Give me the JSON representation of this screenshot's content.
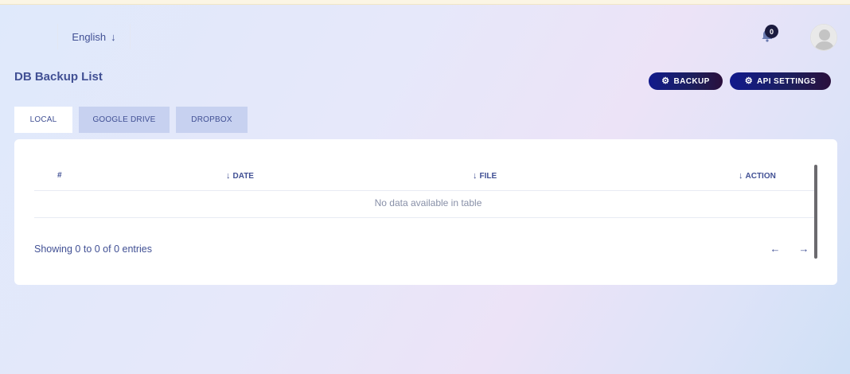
{
  "header": {
    "language": "English",
    "notification_count": "0"
  },
  "page": {
    "title": "DB Backup List"
  },
  "actions": {
    "backup_label": "BACKUP",
    "api_settings_label": "API SETTINGS"
  },
  "tabs": [
    {
      "label": "LOCAL",
      "active": true
    },
    {
      "label": "GOOGLE DRIVE",
      "active": false
    },
    {
      "label": "DROPBOX",
      "active": false
    }
  ],
  "table": {
    "columns": [
      "#",
      "DATE",
      "FILE",
      "ACTION"
    ],
    "empty_message": "No data available in table",
    "info": "Showing 0 to 0 of 0 entries"
  },
  "icons": {
    "language_arrow": "arrow-down-icon",
    "bell": "bell-icon",
    "gear": "gear-icon",
    "sort": "arrow-down-icon",
    "prev": "arrow-left-icon",
    "next": "arrow-right-icon"
  },
  "colors": {
    "primary": "#415094",
    "button_start": "#111a8c",
    "button_end": "#2a0f3c",
    "tab_inactive": "#c7d1f0"
  }
}
